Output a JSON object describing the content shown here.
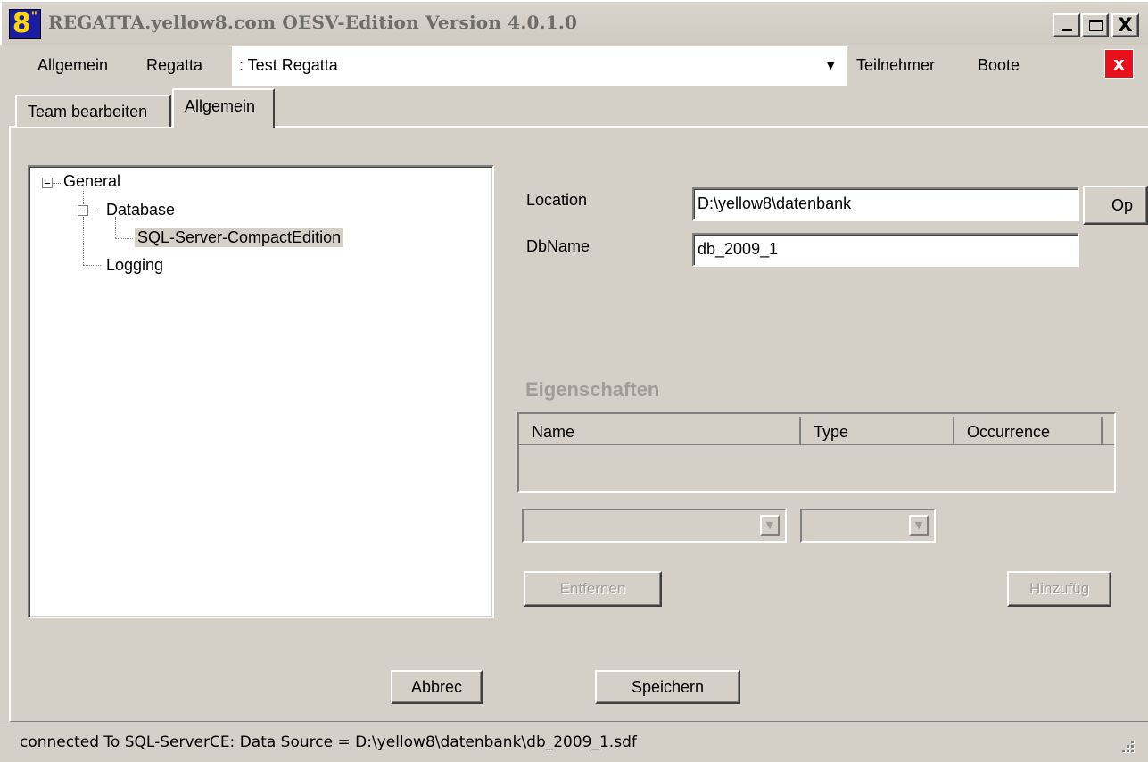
{
  "window": {
    "icon_text": "8",
    "title": "REGATTA.yellow8.com OESV-Edition Version 4.0.1.0",
    "min_icon": "minimize-icon",
    "max_icon": "maximize-icon",
    "close_icon": "close-icon",
    "close_label": "X"
  },
  "menu": {
    "items": [
      "Allgemein",
      "Regatta",
      "Teilnehmer",
      "Boote"
    ],
    "regatta_select": {
      "value": ":  Test Regatta",
      "arrow": "▼"
    },
    "app_close_label": "x",
    "colors": {
      "app_close_bg": "#e8101a"
    }
  },
  "tabs": [
    {
      "label": "Team bearbeiten",
      "selected": false
    },
    {
      "label": "Allgemein",
      "selected": true
    }
  ],
  "tree": {
    "nodes": [
      {
        "label": "General",
        "expanded": true,
        "level": 0
      },
      {
        "label": "Database",
        "expanded": true,
        "level": 1
      },
      {
        "label": "SQL-Server-CompactEdition",
        "selected": true,
        "level": 2
      },
      {
        "label": "Logging",
        "level": 1
      }
    ]
  },
  "settings": {
    "location_label": "Location",
    "location_value": "D:\\yellow8\\datenbank",
    "open_button": "Op",
    "dbname_label": "DbName",
    "dbname_value": "db_2009_1"
  },
  "properties": {
    "heading": "Eigenschaften",
    "columns": [
      "Name",
      "Type",
      "Occurrence"
    ],
    "rows": [],
    "remove_button": "Entfernen",
    "add_button": "Hinzufüg"
  },
  "actions": {
    "cancel_button": "Abbrec",
    "save_button": "Speichern"
  },
  "status": {
    "text": "connected To SQL-ServerCE: Data Source = D:\\yellow8\\datenbank\\db_2009_1.sdf"
  }
}
